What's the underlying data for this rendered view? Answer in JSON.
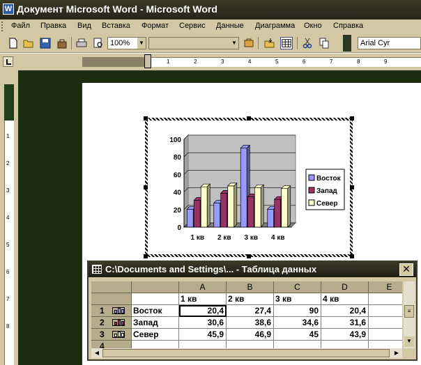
{
  "window": {
    "title": "Документ Microsoft Word - Microsoft Word"
  },
  "menu": [
    "Файл",
    "Правка",
    "Вид",
    "Вставка",
    "Формат",
    "Сервис",
    "Данные",
    "Диаграмма",
    "Окно",
    "Справка"
  ],
  "toolbar": {
    "zoom": "100%",
    "chart_object": "",
    "font": "Arial Cyr"
  },
  "ruler": {
    "numbers": [
      "2",
      "1",
      "1",
      "2",
      "3",
      "4",
      "5",
      "6",
      "7",
      "8",
      "9"
    ]
  },
  "vruler": {
    "numbers": [
      "1",
      "2",
      "3",
      "4",
      "5",
      "6",
      "7",
      "8"
    ]
  },
  "chart_data": {
    "type": "bar",
    "categories": [
      "1 кв",
      "2 кв",
      "3 кв",
      "4 кв"
    ],
    "series": [
      {
        "name": "Восток",
        "values": [
          20.4,
          27.4,
          90,
          20.4
        ]
      },
      {
        "name": "Запад",
        "values": [
          30.6,
          38.6,
          34.6,
          31.6
        ]
      },
      {
        "name": "Север",
        "values": [
          45.9,
          46.9,
          45,
          43.9
        ]
      }
    ],
    "ylim": [
      0,
      100
    ],
    "yticks": [
      "0",
      "20",
      "40",
      "60",
      "80",
      "100"
    ],
    "grid": true,
    "legend": "right",
    "colors": [
      "#9999ff",
      "#993366",
      "#ffffcc"
    ]
  },
  "datasheet": {
    "title": "C:\\Documents and Settings\\... - Таблица данных",
    "close": "✕",
    "columns": [
      "A",
      "B",
      "C",
      "D",
      "E"
    ],
    "header_row": [
      "1 кв",
      "2 кв",
      "3 кв",
      "4 кв"
    ],
    "rows": [
      {
        "num": "1",
        "label": "Восток",
        "values": [
          "20,4",
          "27,4",
          "90",
          "20,4"
        ],
        "color": "#9999ff"
      },
      {
        "num": "2",
        "label": "Запад",
        "values": [
          "30,6",
          "38,6",
          "34,6",
          "31,6"
        ],
        "color": "#993366"
      },
      {
        "num": "3",
        "label": "Север",
        "values": [
          "45,9",
          "46,9",
          "45",
          "43,9"
        ],
        "color": "#ffffcc"
      },
      {
        "num": "4",
        "label": "",
        "values": [
          "",
          "",
          "",
          ""
        ],
        "color": ""
      }
    ]
  }
}
